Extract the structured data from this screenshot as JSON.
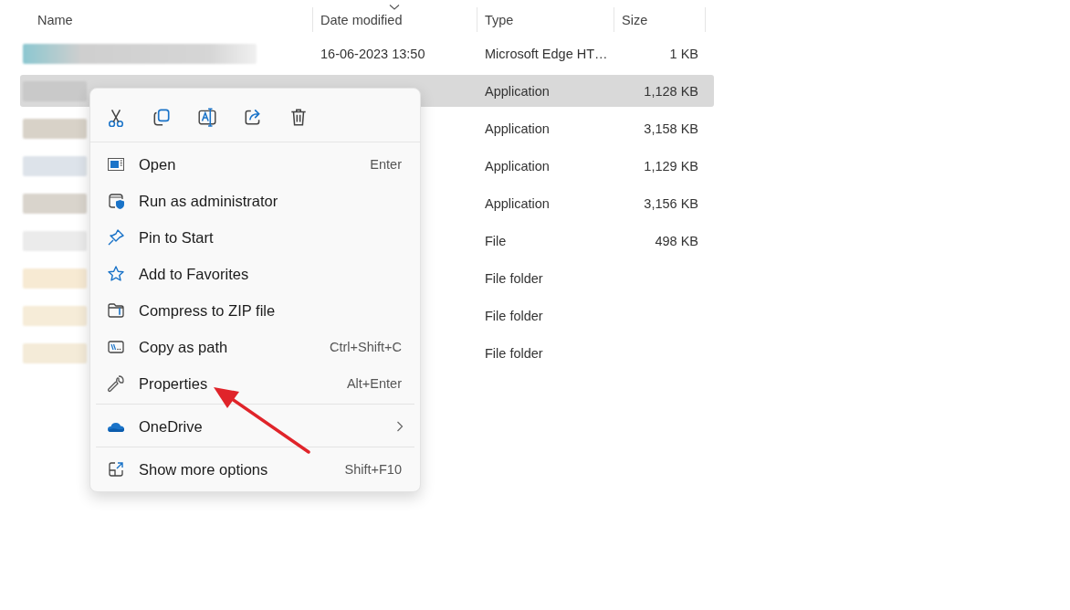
{
  "columns": [
    {
      "label": "Name",
      "sorted": false
    },
    {
      "label": "Date modified",
      "sorted": true
    },
    {
      "label": "Type",
      "sorted": false
    },
    {
      "label": "Size",
      "sorted": false
    }
  ],
  "rows": [
    {
      "date": "16-06-2023 13:50",
      "type": "Microsoft Edge HT…",
      "size": "1 KB",
      "selected": false
    },
    {
      "type": "Application",
      "size": "1,128 KB",
      "selected": true
    },
    {
      "type": "Application",
      "size": "3,158 KB",
      "selected": false
    },
    {
      "type": "Application",
      "size": "1,129 KB",
      "selected": false
    },
    {
      "type": "Application",
      "size": "3,156 KB",
      "selected": false
    },
    {
      "type": "File",
      "size": "498 KB",
      "selected": false
    },
    {
      "type": "File folder",
      "selected": false
    },
    {
      "type": "File folder",
      "selected": false
    },
    {
      "type": "File folder",
      "selected": false
    }
  ],
  "context_menu": {
    "toolbar": [
      {
        "kind": "cut"
      },
      {
        "kind": "copy"
      },
      {
        "kind": "rename"
      },
      {
        "kind": "share"
      },
      {
        "kind": "delete"
      }
    ],
    "sections": [
      [
        {
          "kind": "open",
          "label": "Open",
          "shortcut": "Enter"
        },
        {
          "kind": "admin",
          "label": "Run as administrator"
        },
        {
          "kind": "pin",
          "label": "Pin to Start"
        },
        {
          "kind": "star",
          "label": "Add to Favorites"
        },
        {
          "kind": "zip",
          "label": "Compress to ZIP file"
        },
        {
          "kind": "path",
          "label": "Copy as path",
          "shortcut": "Ctrl+Shift+C"
        },
        {
          "kind": "wrench",
          "label": "Properties",
          "shortcut": "Alt+Enter"
        }
      ],
      [
        {
          "kind": "cloud",
          "label": "OneDrive",
          "submenu": true
        }
      ],
      [
        {
          "kind": "more",
          "label": "Show more options",
          "shortcut": "Shift+F10"
        }
      ]
    ]
  }
}
